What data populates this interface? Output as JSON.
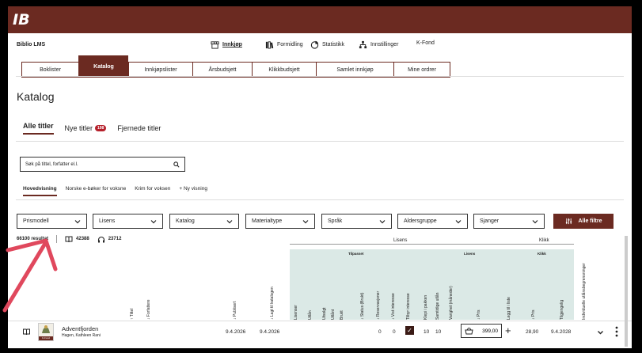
{
  "app": {
    "logo": "IB",
    "name": "Biblio LMS"
  },
  "nav": [
    {
      "label": "Innkjøp",
      "icon": "store-icon"
    },
    {
      "label": "Formidling",
      "icon": "books-icon"
    },
    {
      "label": "Statistikk",
      "icon": "pie-chart-icon"
    },
    {
      "label": "Innstillinger",
      "icon": "org-chart-icon"
    },
    {
      "label": "K-Fond",
      "icon": ""
    }
  ],
  "subtabs": [
    "Boklister",
    "Katalog",
    "Innkjøpslister",
    "Årsbudsjett",
    "Klikkbudsjett",
    "Samlet innkjøp",
    "Mine ordrer"
  ],
  "page_title": "Katalog",
  "title_tabs": {
    "all": "Alle titler",
    "new": "Nye titler",
    "new_badge": "198",
    "removed": "Fjernede titler"
  },
  "search": {
    "placeholder": "Søk på tittel, forfatter el.l."
  },
  "views": {
    "main": "Hovedvisning",
    "v2": "Norske e-bøker for voksne",
    "v3": "Krim for voksen",
    "new": "+  Ny visning"
  },
  "filters": [
    "Prismodell",
    "Lisens",
    "Katalog",
    "Materialtype",
    "Språk",
    "Aldersgruppe",
    "Sjanger"
  ],
  "all_filters": "Alle filtre",
  "counts": {
    "results": "66100 resultat",
    "ebooks": "42388",
    "audiobooks": "23712"
  },
  "groups": {
    "lisens": "Lisens",
    "klikk": "Klikk",
    "tilpasset": "Tilpasset",
    "lisens_sub": "Lisens",
    "klikk_sub": "Klikk"
  },
  "columns": {
    "tittel": "↑  Tittel",
    "forfattere": "↓  Forfattere",
    "publisert": "↓  Publisert",
    "lagt_til": "↓  Lagt til katalogen",
    "lisenser": "Lisenser",
    "utlan": "Utlån",
    "utsolgt": "Utsolgt",
    "utlant": "Utlånt",
    "brukt": "Brukt",
    "status": "↓  Status (Brukt)",
    "reservasjoner": "↓  Reservasjoner",
    "vist_interesse": "↓  Vist interesse",
    "tilbyr": "Tilbyr interesse",
    "klepi": "Klepi i pakken",
    "samtidige": "Samtidige utlån",
    "varighet": "Varighet (måneder)",
    "pris": "↓  Pris",
    "legg_til": "Legg til i liste",
    "klikk_pris": "↓  Pris",
    "tilgjengelig": "Tilgjengelig",
    "individuelle": "Individuelle utlånsbegrensninger"
  },
  "row": {
    "title": "Adventfjorden",
    "authors": "Hagen, Kathleen Rani",
    "cover_label": "K-Fond",
    "published": "9.4.2026",
    "added": "9.4.2026",
    "reservasjoner": "0",
    "vist_interesse": "0",
    "klepi": "10",
    "samtidige": "10",
    "price": "399,00",
    "klikk_price": "28,90",
    "available": "9.4.2028"
  },
  "colors": {
    "brand": "#6b2a21",
    "tint": "#dbe9e6",
    "arrow": "#e0485d",
    "badge": "#b6202b"
  }
}
